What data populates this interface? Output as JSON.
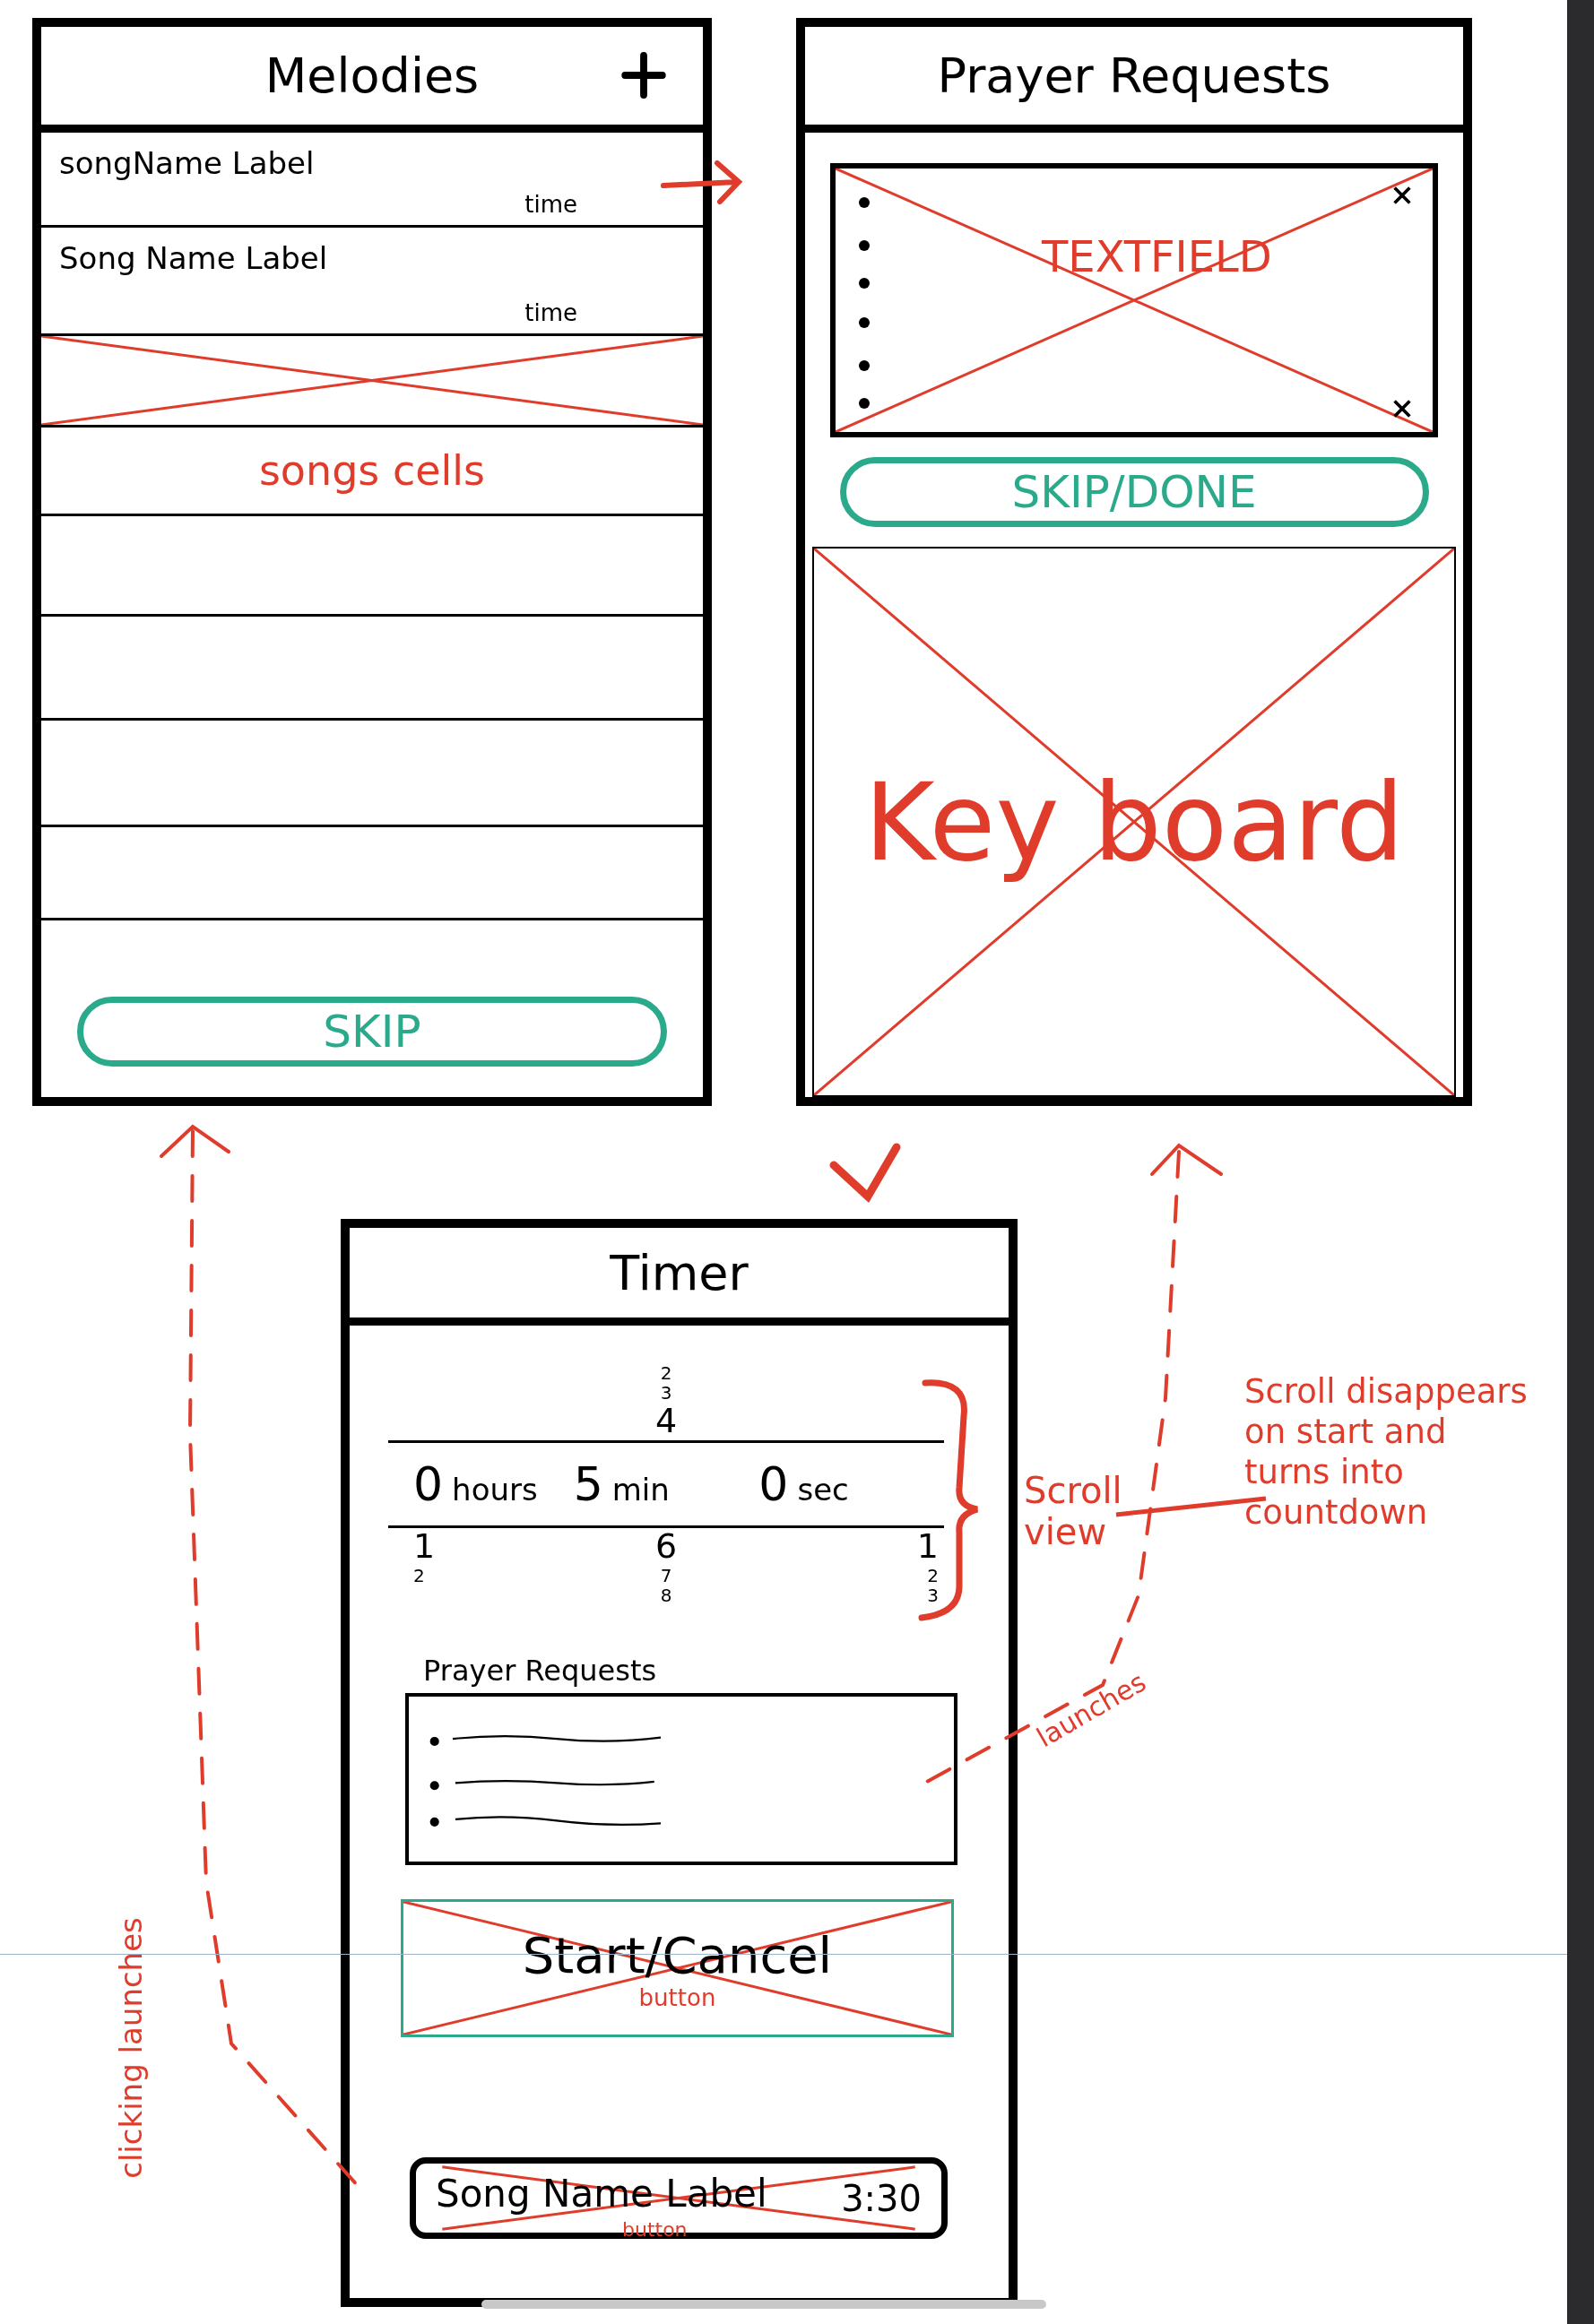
{
  "melodies": {
    "title": "Melodies",
    "rows": [
      {
        "kind": "song",
        "name": "songName Label",
        "time": "time"
      },
      {
        "kind": "song",
        "name": "Song Name Label",
        "time": "time"
      },
      {
        "kind": "crossed"
      },
      {
        "kind": "note",
        "note": "songs cells"
      },
      {
        "kind": "empty"
      },
      {
        "kind": "empty"
      },
      {
        "kind": "empty"
      },
      {
        "kind": "empty"
      }
    ],
    "button": "SKIP"
  },
  "prayer_requests": {
    "title": "Prayer Requests",
    "textfield_note": "TEXTFIELD",
    "button": "SKIP/DONE",
    "keyboard_note": "Key board"
  },
  "timer": {
    "title": "Timer",
    "picker": [
      {
        "value": "0",
        "unit": "hours",
        "below": [
          "1",
          "2"
        ]
      },
      {
        "above": [
          "2",
          "3",
          "4"
        ],
        "value": "5",
        "unit": "min",
        "below": [
          "6",
          "7",
          "8"
        ]
      },
      {
        "value": "0",
        "unit": "sec",
        "below": [
          "1",
          "2",
          "3"
        ]
      }
    ],
    "section_label": "Prayer Requests",
    "start_button": {
      "label": "Start/Cancel",
      "note": "button"
    },
    "song_button": {
      "label": "Song Name Label",
      "time": "3:30",
      "note": "button"
    }
  },
  "annotations": {
    "scroll_view": "Scroll view",
    "scroll_note": [
      "Scroll disappears",
      "on start and",
      "turns into",
      "countdown"
    ],
    "launches": "launches",
    "clicking_launches": "clicking launches"
  }
}
